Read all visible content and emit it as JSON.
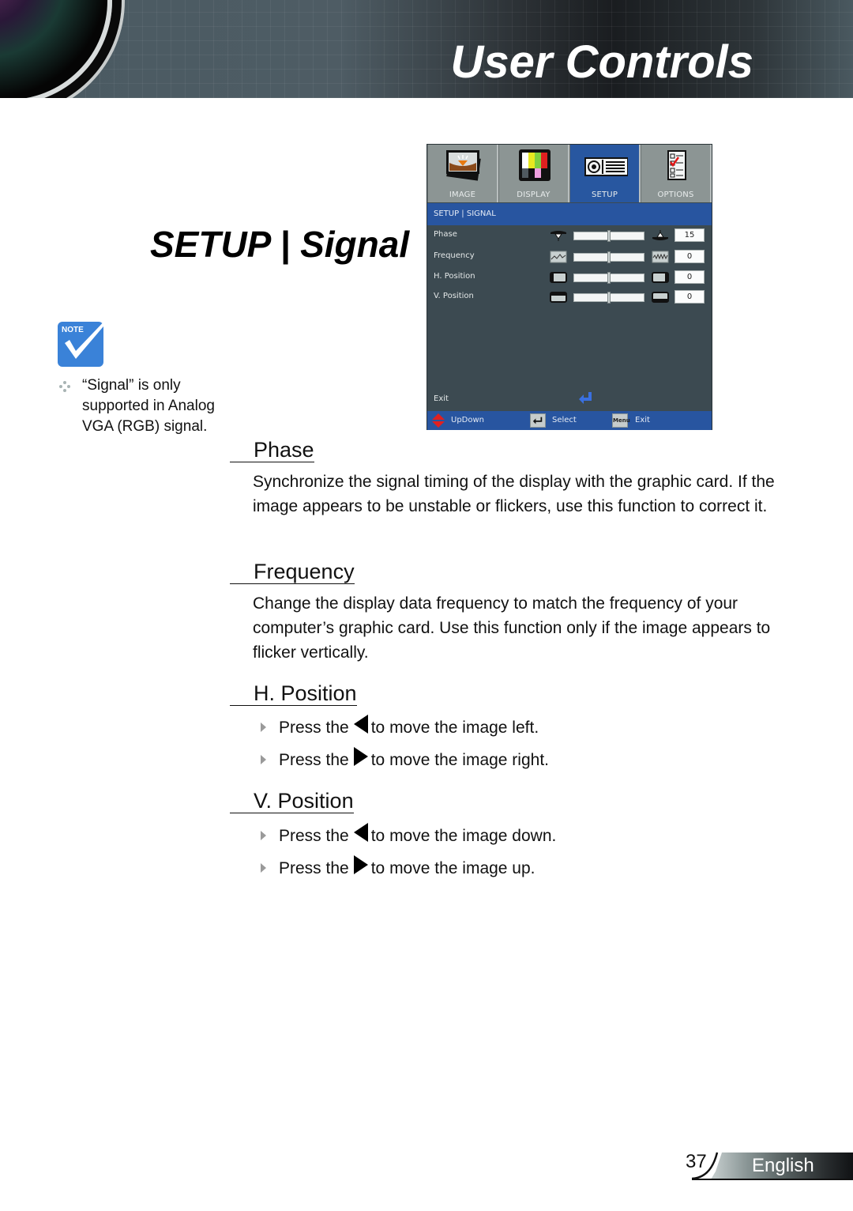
{
  "header": {
    "title": "User Controls"
  },
  "section": {
    "title": "SETUP | Signal"
  },
  "note": {
    "icon_label": "Note",
    "text": "“Signal” is only supported in Analog VGA (RGB) signal."
  },
  "osd": {
    "tabs": [
      {
        "label": "IMAGE",
        "icon": "image-icon",
        "active": false
      },
      {
        "label": "DISPLAY",
        "icon": "display-color-bars-icon",
        "active": false
      },
      {
        "label": "SETUP",
        "icon": "projector-icon",
        "active": true
      },
      {
        "label": "OPTIONS",
        "icon": "checklist-icon",
        "active": false
      }
    ],
    "breadcrumb": "SETUP | SIGNAL",
    "rows": [
      {
        "label": "Phase",
        "value": "15",
        "slider_fraction": 0.5,
        "icon": "phase-icon"
      },
      {
        "label": "Frequency",
        "value": "0",
        "slider_fraction": 0.5,
        "icon": "frequency-icon"
      },
      {
        "label": "H. Position",
        "value": "0",
        "slider_fraction": 0.5,
        "icon": "h-position-icon"
      },
      {
        "label": "V. Position",
        "value": "0",
        "slider_fraction": 0.5,
        "icon": "v-position-icon"
      }
    ],
    "exit_label": "Exit",
    "footer": {
      "updown": "UpDown",
      "select": "Select",
      "menu_key": "Menu",
      "exit": "Exit"
    },
    "colors": {
      "accent": "#2855a0",
      "panel": "#3c4a51",
      "tab_inactive": "#8c9594"
    }
  },
  "content": {
    "phase": {
      "heading": "Phase",
      "body": "Synchronize the signal timing of the display with the graphic card. If the image appears to be unstable or flickers, use this function to correct it."
    },
    "frequency": {
      "heading": "Frequency",
      "body": "Change the display data frequency to match the frequency of your computer’s graphic card. Use this function only if the image appears to flicker vertically."
    },
    "h_position": {
      "heading": "H. Position",
      "items": [
        {
          "prefix": "Press the",
          "key": "left-arrow",
          "suffix": "to move the image left."
        },
        {
          "prefix": "Press the",
          "key": "right-arrow",
          "suffix": "to move the image right."
        }
      ]
    },
    "v_position": {
      "heading": "V. Position",
      "items": [
        {
          "prefix": "Press the",
          "key": "left-arrow",
          "suffix": "to move the image down."
        },
        {
          "prefix": "Press the",
          "key": "right-arrow",
          "suffix": "to move the image up."
        }
      ]
    }
  },
  "footer": {
    "page_number": "37",
    "language": "English"
  }
}
